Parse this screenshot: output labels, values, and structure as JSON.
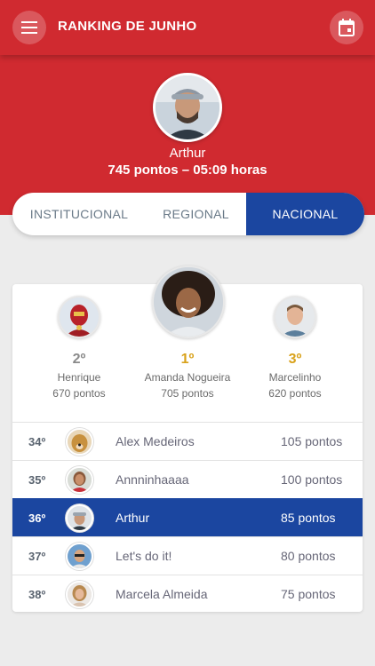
{
  "header": {
    "title": "RANKING DE JUNHO",
    "menu_icon": "menu-icon",
    "calendar_icon": "calendar-icon"
  },
  "me": {
    "name": "Arthur",
    "stats": "745 pontos – 05:09 horas"
  },
  "tabs": [
    {
      "label": "INSTITUCIONAL",
      "active": false
    },
    {
      "label": "REGIONAL",
      "active": false
    },
    {
      "label": "NACIONAL",
      "active": true
    }
  ],
  "podium": {
    "first": {
      "rank": "1º",
      "name": "Amanda Nogueira",
      "points": "705 pontos"
    },
    "second": {
      "rank": "2º",
      "name": "Henrique",
      "points": "670 pontos"
    },
    "third": {
      "rank": "3º",
      "name": "Marcelinho",
      "points": "620 pontos"
    }
  },
  "ranking": [
    {
      "rank": "34º",
      "name": "Alex Medeiros",
      "points": "105 pontos"
    },
    {
      "rank": "35º",
      "name": "Annninhaaaa",
      "points": "100 pontos"
    },
    {
      "rank": "36º",
      "name": "Arthur",
      "points": "85 pontos",
      "highlighted": true
    },
    {
      "rank": "37º",
      "name": "Let's do it!",
      "points": "80 pontos"
    },
    {
      "rank": "38º",
      "name": "Marcela Almeida",
      "points": "75 pontos"
    }
  ],
  "colors": {
    "brand_red": "#d02a30",
    "accent_blue": "#1b46a0",
    "first_gold": "#d9a21b",
    "second_gray": "#8a8a8a"
  }
}
